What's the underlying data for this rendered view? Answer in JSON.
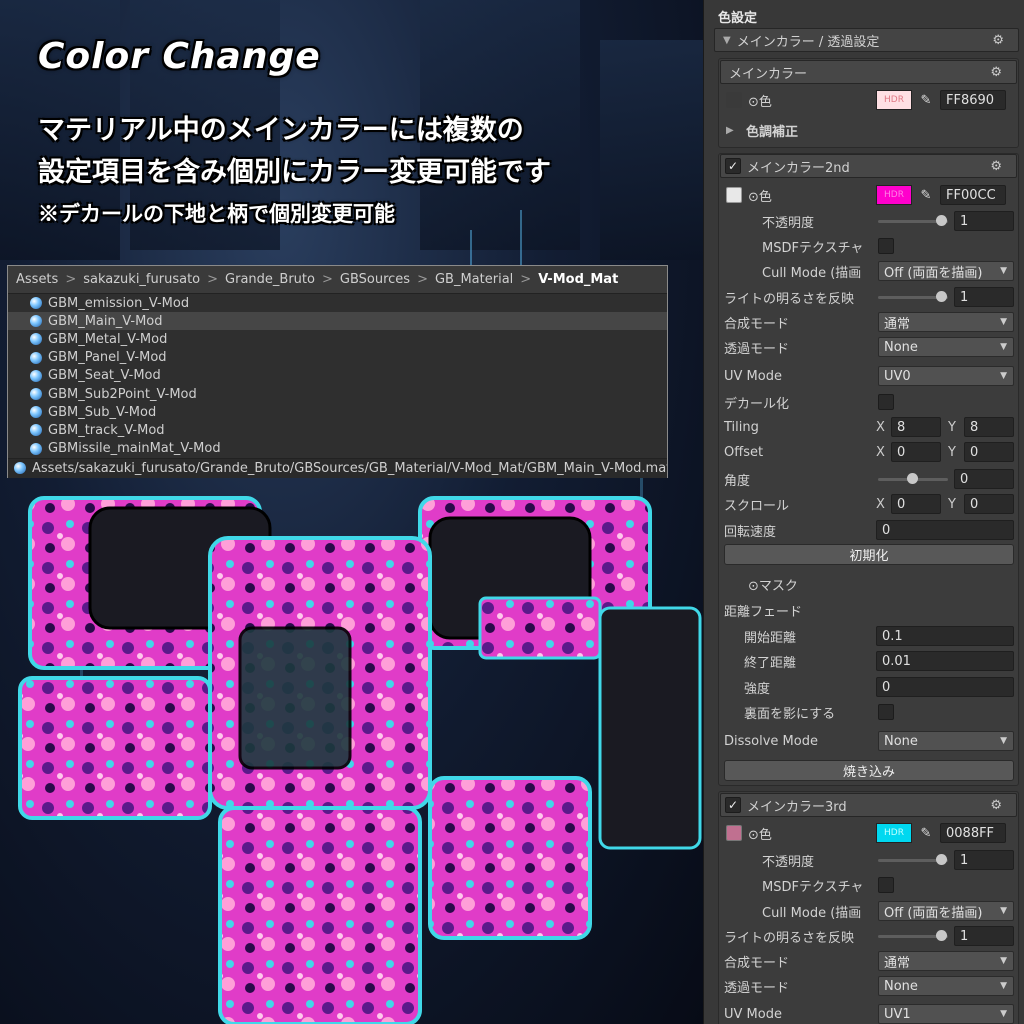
{
  "promo": {
    "headline": "Color Change",
    "line1": "マテリアル中のメインカラーには複数の",
    "line2": "設定項目を含み個別にカラー変更可能です",
    "line3": "※デカールの下地と柄で個別変更可能"
  },
  "project": {
    "breadcrumb": [
      "Assets",
      "sakazuki_furusato",
      "Grande_Bruto",
      "GBSources",
      "GB_Material",
      "V-Mod_Mat"
    ],
    "items": [
      "GBM_emission_V-Mod",
      "GBM_Main_V-Mod",
      "GBM_Metal_V-Mod",
      "GBM_Panel_V-Mod",
      "GBM_Seat_V-Mod",
      "GBM_Sub2Point_V-Mod",
      "GBM_Sub_V-Mod",
      "GBM_track_V-Mod",
      "GBMissile_mainMat_V-Mod"
    ],
    "path": "Assets/sakazuki_furusato/Grande_Bruto/GBSources/GB_Material/V-Mod_Mat/GBM_Main_V-Mod.mat"
  },
  "inspector": {
    "section_title": "色設定",
    "main_section": "メインカラー / 透過設定",
    "main_color": {
      "title": "メインカラー",
      "color_label": "⊙色",
      "hdr": "HDR",
      "hex": "FF8690",
      "tone": "色調補正"
    },
    "color2": {
      "title": "メインカラー2nd",
      "color_label": "⊙色",
      "hdr": "HDR",
      "hex": "FF00CC",
      "opacity_label": "不透明度",
      "opacity_value": "1",
      "msdf_label": "MSDFテクスチャ",
      "cull_label": "Cull Mode (描画",
      "cull_value": "Off (両面を描画)",
      "light_label": "ライトの明るさを反映",
      "light_value": "1",
      "blend_label": "合成モード",
      "blend_value": "通常",
      "alpha_label": "透過モード",
      "alpha_value": "None",
      "uv_label": "UV Mode",
      "uv_value": "UV0",
      "decal_label": "デカール化",
      "tiling_label": "Tiling",
      "tiling_x": "8",
      "tiling_y": "8",
      "offset_label": "Offset",
      "offset_x": "0",
      "offset_y": "0",
      "angle_label": "角度",
      "angle_value": "0",
      "scroll_label": "スクロール",
      "scroll_x": "0",
      "scroll_y": "0",
      "rot_label": "回転速度",
      "rot_value": "0",
      "reset_btn": "初期化",
      "mask_label": "⊙マスク",
      "fade_label": "距離フェード",
      "fade_start_label": "開始距離",
      "fade_start": "0.1",
      "fade_end_label": "終了距離",
      "fade_end": "0.01",
      "strength_label": "強度",
      "strength": "0",
      "backface_label": "裏面を影にする",
      "dissolve_label": "Dissolve Mode",
      "dissolve_value": "None",
      "bake_btn": "焼き込み"
    },
    "color3": {
      "title": "メインカラー3rd",
      "color_label": "⊙色",
      "hdr": "HDR",
      "hex": "0088FF",
      "opacity_label": "不透明度",
      "opacity_value": "1",
      "msdf_label": "MSDFテクスチャ",
      "cull_label": "Cull Mode (描画",
      "cull_value": "Off (両面を描画)",
      "light_label": "ライトの明るさを反映",
      "light_value": "1",
      "blend_label": "合成モード",
      "blend_value": "通常",
      "alpha_label": "透過モード",
      "alpha_value": "None",
      "uv_label": "UV Mode",
      "uv_value": "UV1"
    },
    "axis_x": "X",
    "axis_y": "Y"
  },
  "colors": {
    "main_swatch": "#FF8690",
    "second_swatch": "#FF00CC",
    "third_swatch": "#0088FF",
    "panel_bg": "#383838",
    "mech_pink": "#e040c8",
    "mech_cyan": "#40d8e8"
  },
  "icons": [
    "gear-icon",
    "eyedropper-icon",
    "material-orb-icon",
    "checkbox-icon",
    "foldout-arrow-icon"
  ]
}
